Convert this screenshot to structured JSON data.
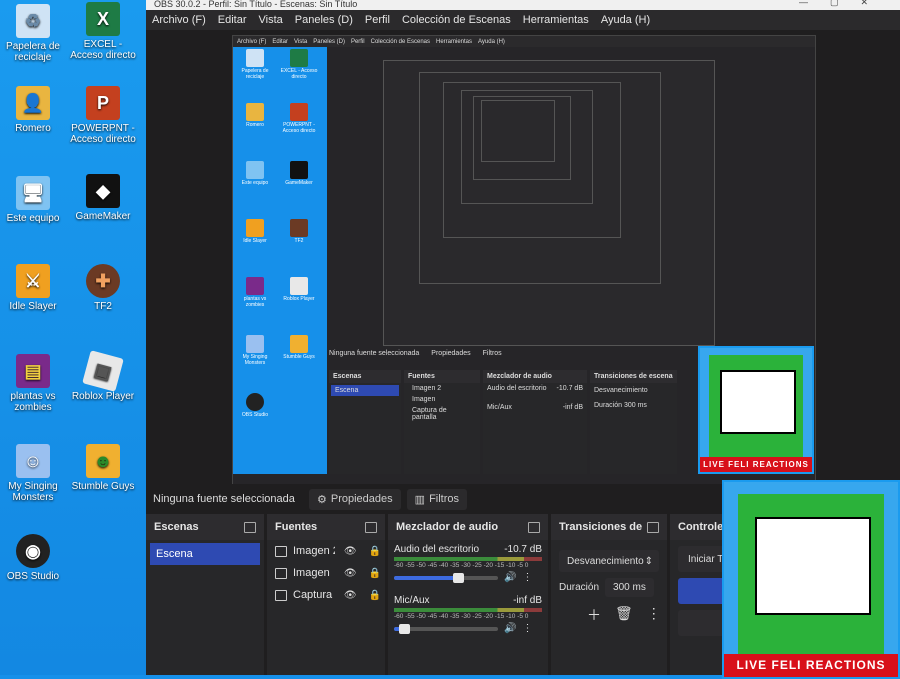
{
  "desktop": {
    "icons": [
      {
        "label": "Papelera de reciclaje",
        "icon": "recycle-bin-icon"
      },
      {
        "label": "EXCEL - Acceso directo",
        "icon": "excel-icon"
      },
      {
        "label": "Romero",
        "icon": "user-folder-icon"
      },
      {
        "label": "POWERPNT - Acceso directo",
        "icon": "powerpoint-icon"
      },
      {
        "label": "Este equipo",
        "icon": "computer-icon"
      },
      {
        "label": "GameMaker",
        "icon": "gamemaker-icon"
      },
      {
        "label": "Idle Slayer",
        "icon": "sword-icon"
      },
      {
        "label": "TF2",
        "icon": "tf2-icon"
      },
      {
        "label": "plantas vs zombies",
        "icon": "winrar-icon"
      },
      {
        "label": "Roblox Player",
        "icon": "roblox-icon"
      },
      {
        "label": "My Singing Monsters",
        "icon": "monster-icon"
      },
      {
        "label": "Stumble Guys",
        "icon": "stumble-icon"
      },
      {
        "label": "OBS Studio",
        "icon": "obs-icon"
      }
    ]
  },
  "obs": {
    "title": "OBS 30.0.2 - Perfil: Sin Título - Escenas: Sin Título",
    "menu": [
      "Archivo (F)",
      "Editar",
      "Vista",
      "Paneles (D)",
      "Perfil",
      "Colección de Escenas",
      "Herramientas",
      "Ayuda (H)"
    ],
    "source_bar": {
      "no_source": "Ninguna fuente seleccionada",
      "properties": "Propiedades",
      "filters": "Filtros"
    },
    "scenes": {
      "title": "Escenas",
      "items": [
        "Escena"
      ]
    },
    "sources": {
      "title": "Fuentes",
      "items": [
        "Imagen 2",
        "Imagen",
        "Captura de pantalla"
      ]
    },
    "mixer": {
      "title": "Mezclador de audio",
      "ticks": "-60 -55 -50 -45 -40 -35 -30 -25 -20 -15 -10 -5 0",
      "channels": [
        {
          "name": "Audio del escritorio",
          "db": "-10.7 dB",
          "volume": 0.62
        },
        {
          "name": "Mic/Aux",
          "db": "-inf dB",
          "volume": 0.1
        }
      ]
    },
    "transitions": {
      "title": "Transiciones de escena",
      "type": "Desvanecimiento",
      "duration_label": "Duración",
      "duration": "300 ms"
    },
    "controls": {
      "title": "Controles",
      "buttons": [
        "Iniciar Transmisión",
        "",
        "",
        "",
        ""
      ]
    }
  },
  "overlay": {
    "banner": "LIVE FELI REACTIONS"
  },
  "colors": {
    "accent": "#2e4ab2",
    "desktop": "#1690ea",
    "obs_bg": "#1f1e1f",
    "banner": "#d8101a"
  }
}
